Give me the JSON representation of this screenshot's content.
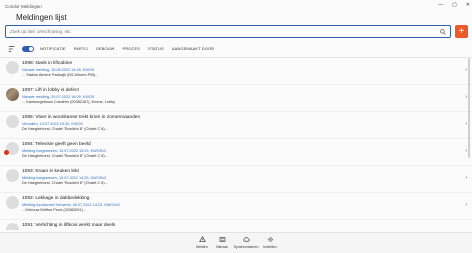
{
  "window": {
    "app_title": "Condor Meldingen",
    "controls": [
      "—",
      "▢",
      "✕"
    ]
  },
  "page": {
    "title": "Meldingen lijst"
  },
  "search": {
    "placeholder": "Zoek op titel, omschrijving, etc.",
    "value": ""
  },
  "add_button": {
    "label": "+"
  },
  "filters": {
    "active_toggle": true,
    "tabs": [
      "NOTIFICATIE",
      "PARTIJ",
      "GEBOUW",
      "PROCES",
      "STATUS",
      "AANGEMAAKT DOOR"
    ]
  },
  "items": [
    {
      "title": "1098: stank in liftcabine",
      "status": "Nieuwe melding, 15.08.2022 14:39, KWO5",
      "location": "... Station Almere Parkwijk (NS Almere-PW)...",
      "photo": false,
      "badge": false
    },
    {
      "title": "1097: Lift in lobby is defect",
      "status": "Nieuwe melding, 29.07.2022 16:09, KWO5",
      "location": "... Kantoorgebouw Cosdenn (00382187), Emme, Lobby",
      "photo": true,
      "badge": false
    },
    {
      "title": "1095: Vloer in woonkamer trekt krom in zomermaanden",
      "status": "Vervallen, 13.07.2022 15:32, KWO5",
      "location": "De Haeghehorst, Chalet \"Bosticht 8\" (Chalet C 8)...",
      "photo": false,
      "badge": false
    },
    {
      "title": "1094: Televisie geeft geen beeld",
      "status": "Melding toegewezen, 13.07.2022 15:29, KWOSv2",
      "location": "De Haeghehorst, Chalet \"Bosticht 8\" (Chalet C 8)...",
      "photo": false,
      "badge": true
    },
    {
      "title": "1093: Kraan in keuken lekt",
      "status": "Melding toegewezen, 13.07.2022 14:25, KWOSv2",
      "location": "De Haeghehorst, Chalet \"Bosticht 8\" (Chalet C 8)...",
      "photo": false,
      "badge": false
    },
    {
      "title": "1092: Lekkage in dakbedekking",
      "status": "Melding functioneel Verwerkt, 06.07.2022 14:23, KWOSv2",
      "location": "...Gebouw Delftse Poort (00382091)...",
      "photo": false,
      "badge": false
    },
    {
      "title": "1091: Verlichting in liftkooi werkt maar deels",
      "status": "",
      "location": "",
      "photo": false,
      "badge": false
    }
  ],
  "nav": [
    {
      "label": "Melden",
      "icon": "alert-icon"
    },
    {
      "label": "Nieuws",
      "icon": "news-icon"
    },
    {
      "label": "Synchroniseren",
      "icon": "cloud-sync-icon"
    },
    {
      "label": "Instellen",
      "icon": "gear-icon"
    }
  ]
}
